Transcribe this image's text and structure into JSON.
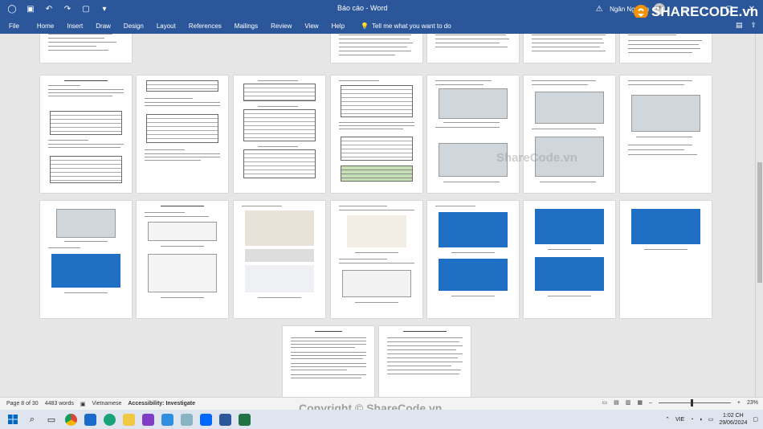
{
  "titlebar": {
    "title": "Báo cáo - Word",
    "user": "Ngân Nguyễn",
    "avatar_initials": "NN",
    "qa_icons": [
      "save-icon",
      "undo-icon",
      "redo-icon",
      "touch-mode-icon",
      "customize-icon"
    ],
    "window_icons": [
      "ribbon-display-icon",
      "minimize-icon",
      "maximize-icon",
      "close-icon"
    ]
  },
  "ribbon": {
    "tabs": [
      "File",
      "Home",
      "Insert",
      "Draw",
      "Design",
      "Layout",
      "References",
      "Mailings",
      "Review",
      "View",
      "Help"
    ],
    "tell_me": "Tell me what you want to do"
  },
  "watermark": {
    "logo_text": "SHARECODE.vn",
    "mid_text": "ShareCode.vn",
    "bottom_text": "Copyright © ShareCode.vn"
  },
  "statusbar": {
    "page": "Page 8 of 30",
    "words": "4483 words",
    "language": "Vietnamese",
    "accessibility": "Accessibility: Investigate",
    "zoom": "23%"
  },
  "taskbar": {
    "language": "VIE",
    "time": "1:02 CH",
    "date": "29/06/2024"
  },
  "colors": {
    "word_blue": "#2b579a",
    "sharecode_orange": "#f39200"
  }
}
